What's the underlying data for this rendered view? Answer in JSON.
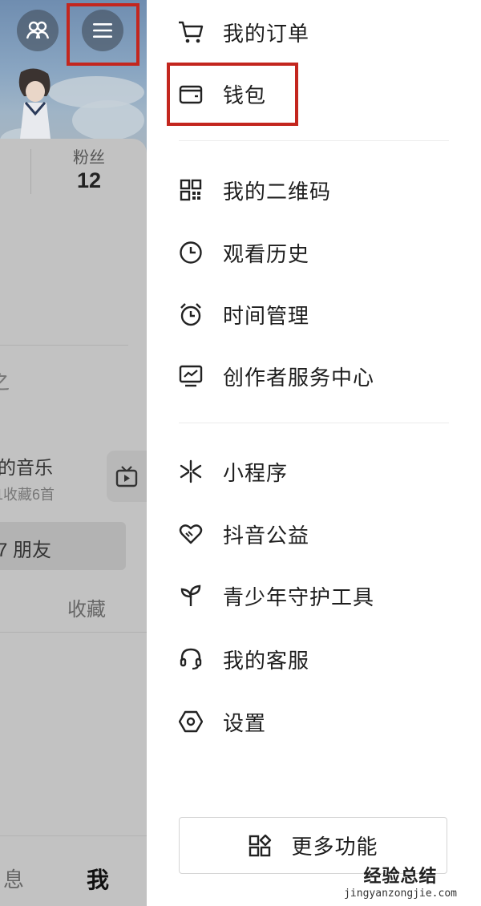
{
  "left_panel": {
    "fans_label": "粉丝",
    "fans_count": "12",
    "partial_text": "之",
    "music_title": "我的音乐",
    "music_sub": "1收藏6首",
    "friend_text": "7 朋友",
    "favorites_label": "收藏",
    "nav_messages": "息",
    "nav_me": "我"
  },
  "menu": {
    "items": [
      {
        "label": "我的订单",
        "icon": "cart-icon"
      },
      {
        "label": "钱包",
        "icon": "wallet-icon"
      },
      {
        "label": "我的二维码",
        "icon": "qrcode-icon"
      },
      {
        "label": "观看历史",
        "icon": "clock-icon"
      },
      {
        "label": "时间管理",
        "icon": "alarm-clock-icon"
      },
      {
        "label": "创作者服务中心",
        "icon": "chart-monitor-icon"
      },
      {
        "label": "小程序",
        "icon": "sparkle-icon"
      },
      {
        "label": "抖音公益",
        "icon": "heart-icon"
      },
      {
        "label": "青少年守护工具",
        "icon": "sprout-icon"
      },
      {
        "label": "我的客服",
        "icon": "headset-icon"
      },
      {
        "label": "设置",
        "icon": "hexagon-settings-icon"
      }
    ],
    "more_button": "更多功能"
  },
  "watermark": {
    "title": "经验总结",
    "url": "jingyanzongjie.com"
  },
  "colors": {
    "highlight": "#c3261e",
    "text": "#1e1e1e",
    "dim_overlay": "#bdbdbd"
  }
}
